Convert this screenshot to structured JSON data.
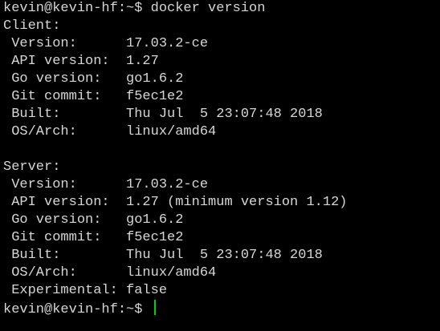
{
  "colors": {
    "background": "#000000",
    "text": "#d6d6d6",
    "cursor": "#00d000"
  },
  "terminal": {
    "lines": [
      "kevin@kevin-hf:~$ docker version",
      "Client:",
      " Version:      17.03.2-ce",
      " API version:  1.27",
      " Go version:   go1.6.2",
      " Git commit:   f5ec1e2",
      " Built:        Thu Jul  5 23:07:48 2018",
      " OS/Arch:      linux/amd64",
      "",
      "Server:",
      " Version:      17.03.2-ce",
      " API version:  1.27 (minimum version 1.12)",
      " Go version:   go1.6.2",
      " Git commit:   f5ec1e2",
      " Built:        Thu Jul  5 23:07:48 2018",
      " OS/Arch:      linux/amd64",
      " Experimental: false"
    ],
    "prompt": "kevin@kevin-hf:~$ "
  }
}
